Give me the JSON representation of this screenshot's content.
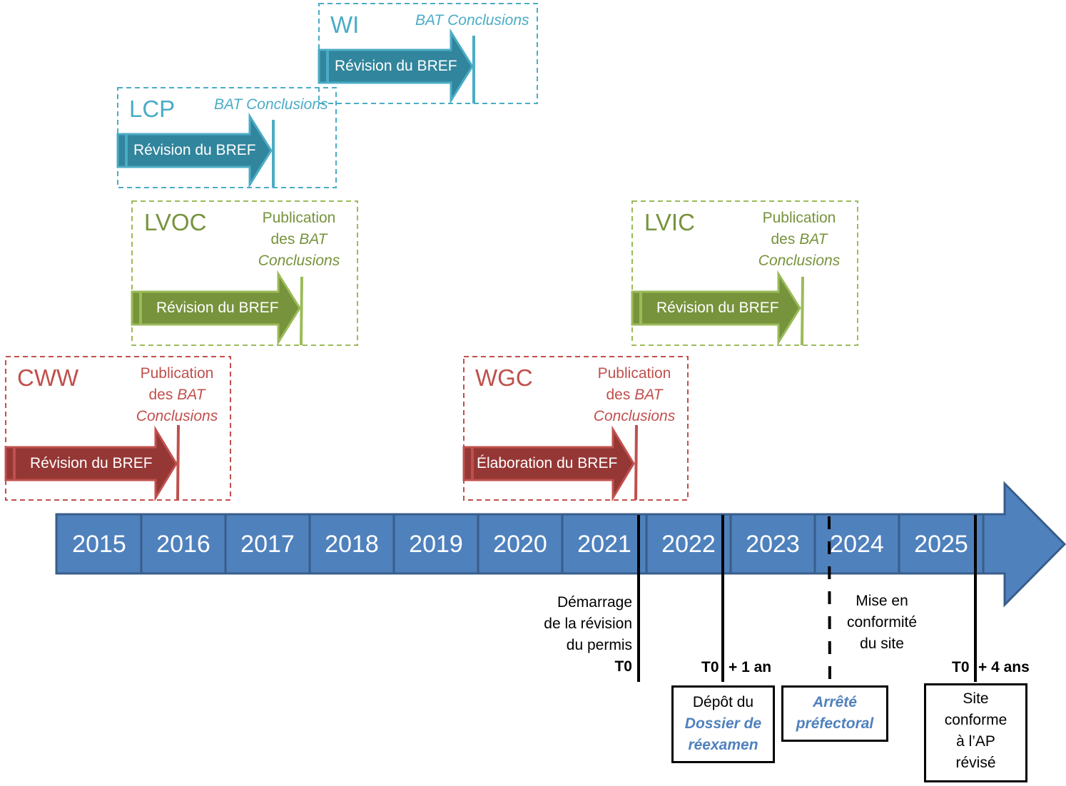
{
  "colors": {
    "teal": "#4bacc6",
    "teal_dark": "#31859c",
    "green": "#9bbb59",
    "green_dark": "#77933c",
    "red": "#c0504d",
    "red_dark": "#953735",
    "timeline": "#4f81bd",
    "timeline_border": "#385d8a"
  },
  "groups": [
    {
      "name": "WI",
      "pub_line1": "",
      "pub_line2": "",
      "pub_italic": "BAT Conclusions",
      "arrow": "Révision du BREF"
    },
    {
      "name": "LCP",
      "pub_line1": "",
      "pub_line2": "",
      "pub_italic": "BAT Conclusions",
      "arrow": "Révision du BREF"
    },
    {
      "name": "LVOC",
      "pub_line1": "Publication",
      "pub_line2": "des",
      "pub_italic_mid": "BAT",
      "pub_italic": "Conclusions",
      "arrow": "Révision du BREF"
    },
    {
      "name": "LVIC",
      "pub_line1": "Publication",
      "pub_line2": "des",
      "pub_italic_mid": "BAT",
      "pub_italic": "Conclusions",
      "arrow": "Révision du BREF"
    },
    {
      "name": "CWW",
      "pub_line1": "Publication",
      "pub_line2": "des",
      "pub_italic_mid": "BAT",
      "pub_italic": "Conclusions",
      "arrow": "Révision du BREF"
    },
    {
      "name": "WGC",
      "pub_line1": "Publication",
      "pub_line2": "des",
      "pub_italic_mid": "BAT",
      "pub_italic": "Conclusions",
      "arrow": "Élaboration du BREF"
    }
  ],
  "years": [
    "2015",
    "2016",
    "2017",
    "2018",
    "2019",
    "2020",
    "2021",
    "2022",
    "2023",
    "2024",
    "2025"
  ],
  "milestones": {
    "start": {
      "l1": "Démarrage",
      "l2": "de la révision",
      "l3": "du permis",
      "t0": "T0"
    },
    "plus1": {
      "t0": "T0",
      "offset": "+ 1 an"
    },
    "compliance": {
      "l1": "Mise en",
      "l2": "conformité",
      "l3": "du site"
    },
    "plus4": {
      "t0": "T0",
      "offset": "+ 4 ans"
    }
  },
  "boxes": {
    "depot": {
      "l1": "Dépôt du",
      "l2": "Dossier de",
      "l3": "réexamen"
    },
    "arrete": {
      "l1": "Arrêté",
      "l2": "préfectoral"
    },
    "site": {
      "l1": "Site",
      "l2": "conforme",
      "l3": "à l’AP",
      "l4": "révisé"
    }
  }
}
